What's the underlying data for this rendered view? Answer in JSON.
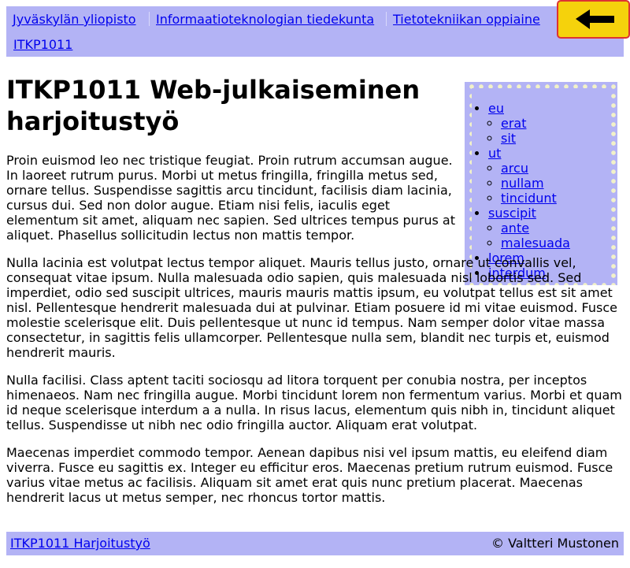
{
  "nav": {
    "breadcrumbs": [
      "Jyväskylän yliopisto",
      "Informaatioteknologian tiedekunta",
      "Tietotekniikan oppiaine",
      "ITKP1011"
    ],
    "back_icon": "left-arrow-icon",
    "back_colors": {
      "background": "#f5d20c",
      "border": "#d33",
      "arrow": "#000000"
    }
  },
  "page": {
    "title": "ITKP1011 Web-julkaiseminen harjoitustyö",
    "paragraphs": [
      "Proin euismod leo nec tristique feugiat. Proin rutrum accumsan augue. In laoreet rutrum purus. Morbi ut metus fringilla, fringilla metus sed, ornare tellus. Suspendisse sagittis arcu tincidunt, facilisis diam lacinia, cursus dui. Sed non dolor augue. Etiam nisi felis, iaculis eget elementum sit amet, aliquam nec sapien. Sed ultrices tempus purus at aliquet. Phasellus sollicitudin lectus non mattis tempor.",
      "Nulla lacinia est volutpat lectus tempor aliquet. Mauris tellus justo, ornare ut convallis vel, consequat vitae ipsum. Nulla malesuada odio sapien, quis malesuada nisl lobortis sed. Sed imperdiet, odio sed suscipit ultrices, mauris mauris mattis ipsum, eu volutpat tellus est sit amet nisl. Pellentesque hendrerit malesuada dui at pulvinar. Etiam posuere id mi vitae euismod. Fusce molestie scelerisque elit. Duis pellentesque ut nunc id tempus. Nam semper dolor vitae massa consectetur, in sagittis felis ullamcorper. Pellentesque nulla sem, blandit nec turpis et, euismod hendrerit mauris.",
      "Nulla facilisi. Class aptent taciti sociosqu ad litora torquent per conubia nostra, per inceptos himenaeos. Nam nec fringilla augue. Morbi tincidunt lorem non fermentum varius. Morbi et quam id neque scelerisque interdum a a nulla. In risus lacus, elementum quis nibh in, tincidunt aliquet tellus. Suspendisse ut nibh nec odio fringilla auctor. Aliquam erat volutpat.",
      "Maecenas imperdiet commodo tempor. Aenean dapibus nisi vel ipsum mattis, eu eleifend diam viverra. Fusce eu sagittis ex. Integer eu efficitur eros. Maecenas pretium rutrum euismod. Fusce varius vitae metus ac facilisis. Aliquam sit amet erat quis nunc pretium placerat. Maecenas hendrerit lacus ut metus semper, nec rhoncus tortor mattis."
    ]
  },
  "sidenav": {
    "items": [
      {
        "label": "eu",
        "children": [
          "erat",
          "sit"
        ]
      },
      {
        "label": "ut",
        "children": [
          "arcu",
          "nullam",
          "tincidunt"
        ]
      },
      {
        "label": "suscipit",
        "children": [
          "ante",
          "malesuada"
        ]
      },
      {
        "label": "lorem",
        "children": []
      },
      {
        "label": "interdum",
        "children": []
      }
    ]
  },
  "footer": {
    "link": "ITKP1011 Harjoitustyö",
    "copyright": "© Valtteri Mustonen"
  },
  "colors": {
    "nav_background": "#b3b3f5",
    "link": "#0000ee",
    "sidenav_dots": "#f2f2c8"
  }
}
